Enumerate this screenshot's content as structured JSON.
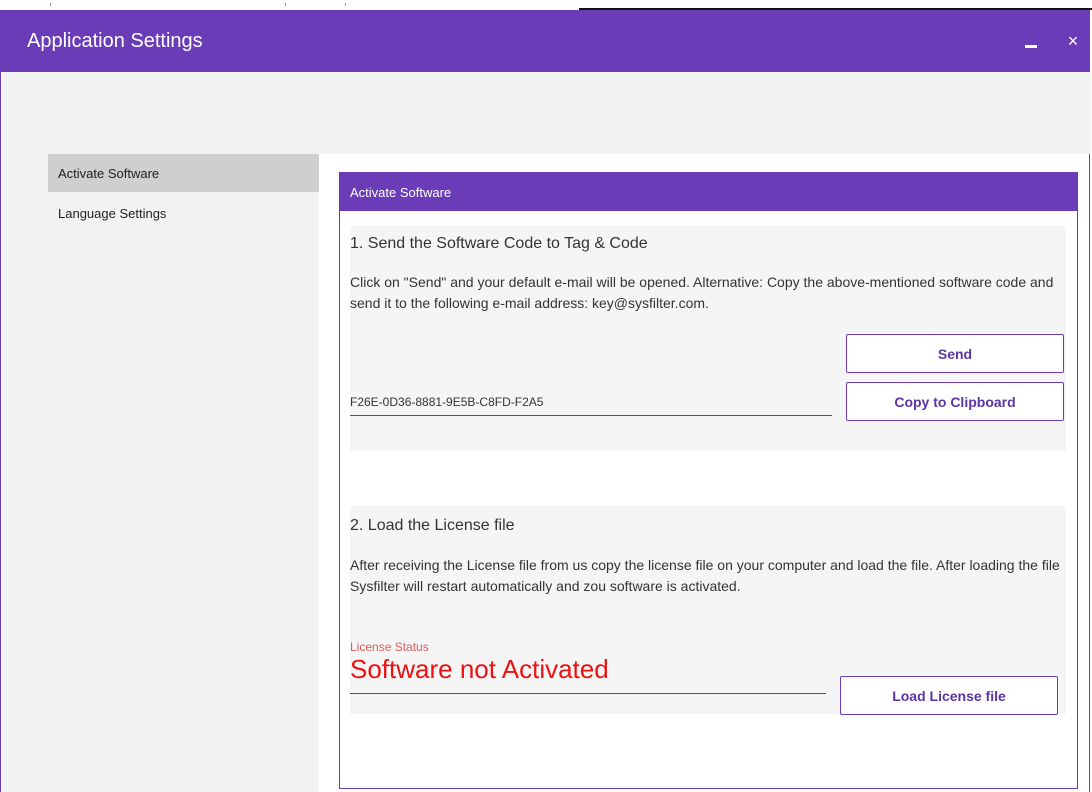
{
  "window": {
    "title": "Application Settings",
    "minimize_icon": "minimize-icon",
    "close_glyph": "×"
  },
  "sidebar": {
    "items": [
      {
        "label": "Activate Software",
        "active": true
      },
      {
        "label": "Language Settings",
        "active": false
      }
    ]
  },
  "panel": {
    "header": "Activate Software",
    "section1": {
      "title": "1. Send the Software Code to Tag & Code",
      "text": "Click on \"Send\" and your default e-mail will be opened. Alternative: Copy the above-mentioned software code and send it to the following e-mail address: key@sysfilter.com.",
      "send_label": "Send",
      "copy_label": "Copy to Clipboard",
      "software_code": "F26E-0D36-8881-9E5B-C8FD-F2A5"
    },
    "section2": {
      "title": "2. Load the License file",
      "text": "After receiving the License file from us copy the license file on your computer and load the file. After loading the file Sysfilter will restart automatically and zou software is activated.",
      "status_label": "License Status",
      "status_value": "Software not Activated",
      "load_label": "Load License file"
    }
  },
  "colors": {
    "accent": "#6a3cb7",
    "status_red": "#ee1111"
  }
}
